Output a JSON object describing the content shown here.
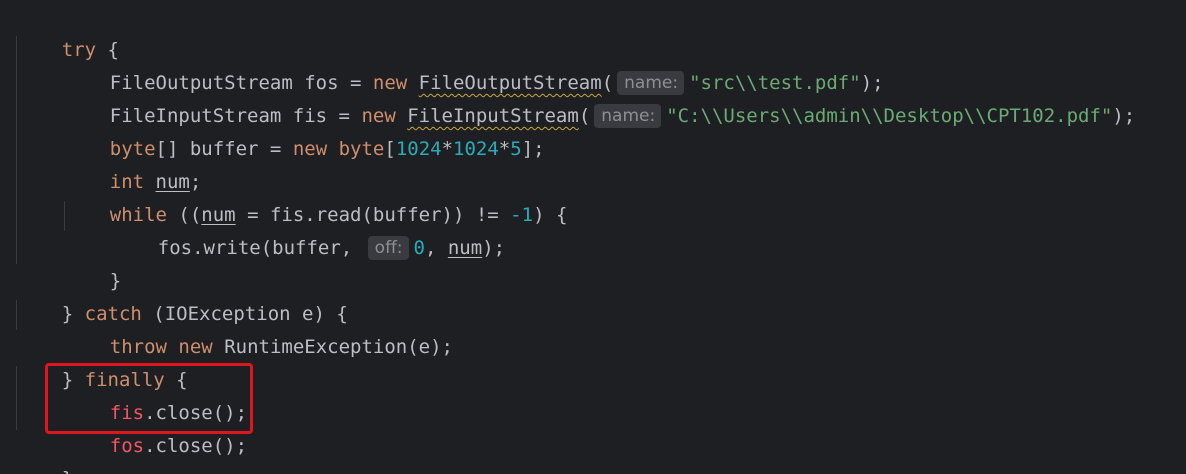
{
  "code": {
    "l1": {
      "kw_try": "try",
      "brace": " {"
    },
    "l2": {
      "t1": "FileOutputStream fos = ",
      "kw_new": "new",
      "sp": " ",
      "ctor": "FileOutputStream",
      "paren": "(",
      "hint": "name:",
      "str": "\"src\\\\test.pdf\"",
      "end": ");"
    },
    "l3": {
      "t1": "FileInputStream fis = ",
      "kw_new": "new",
      "sp": " ",
      "ctor": "FileInputStream",
      "paren": "(",
      "hint": "name:",
      "str": "\"C:\\\\Users\\\\admin\\\\Desktop\\\\CPT102.pdf\"",
      "end": ");"
    },
    "l4": {
      "kw_byte": "byte",
      "t1": "[] buffer = ",
      "kw_new": "new",
      "sp": " ",
      "kw_byte2": "byte",
      "br": "[",
      "n1": "1024",
      "op1": "*",
      "n2": "1024",
      "op2": "*",
      "n3": "5",
      "end": "];"
    },
    "l5": {
      "kw_int": "int",
      "sp": " ",
      "var": "num",
      "end": ";"
    },
    "l6": {
      "kw_while": "while",
      "t1": " ((",
      "var": "num",
      "t2": " = fis.read(buffer)) != ",
      "n": "-1",
      "end": ") {"
    },
    "l7": {
      "t1": "fos.write(buffer, ",
      "hint": "off:",
      "n": "0",
      "t2": ", ",
      "var": "num",
      "end": ");"
    },
    "l8": {
      "brace": "}"
    },
    "l9": {
      "b": "} ",
      "kw_catch": "catch",
      "t1": " (IOException e) {"
    },
    "l10": {
      "kw_throw": "throw",
      "sp": " ",
      "kw_new": "new",
      "t1": " RuntimeException(e);"
    },
    "l11": {
      "b": "} ",
      "kw_finally": "finally",
      "t1": " {"
    },
    "l12": {
      "err": "fis",
      "t1": ".close();"
    },
    "l13": {
      "err": "fos",
      "t1": ".close();"
    },
    "l14": {
      "brace": "}"
    }
  },
  "colors": {
    "background": "#1e1f22",
    "keyword": "#cf8e6d",
    "string": "#6aab73",
    "number": "#2aacb8",
    "text": "#bcbec4",
    "error": "#f75464",
    "annotation_box": "#e0161f"
  }
}
